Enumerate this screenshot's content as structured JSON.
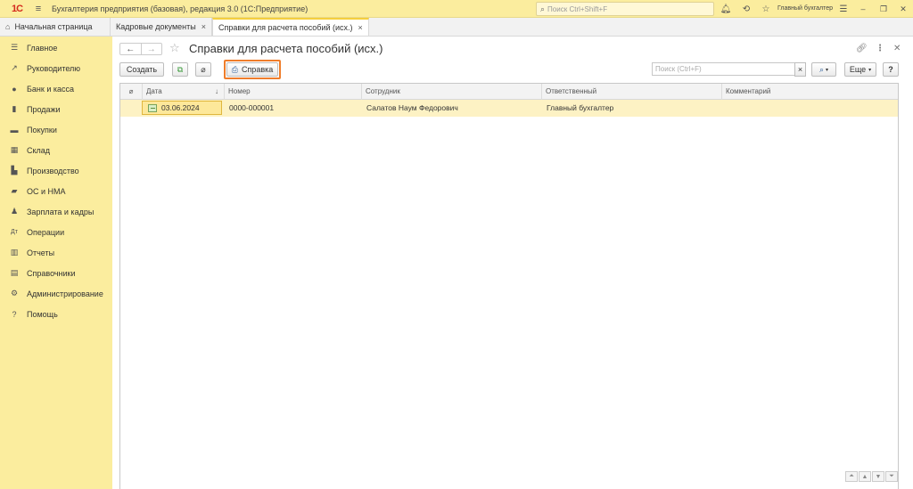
{
  "titlebar": {
    "logo": "1С",
    "app_title": "Бухгалтерия предприятия (базовая), редакция 3.0  (1С:Предприятие)",
    "search_placeholder": "Поиск Ctrl+Shift+F",
    "user": "Главный бухгалтер",
    "icons": [
      "menu-icon",
      "search-icon",
      "bell-icon",
      "history-icon",
      "star-icon",
      "settings-icon",
      "minimize-icon",
      "restore-icon",
      "close-icon"
    ]
  },
  "tabs": {
    "home": "Начальная страница",
    "items": [
      {
        "label": "Кадровые документы",
        "close": "×"
      },
      {
        "label": "Справки для расчета пособий (исх.)",
        "close": "×"
      }
    ]
  },
  "sidebar": {
    "items": [
      {
        "label": "Главное",
        "icon": "menu-icon"
      },
      {
        "label": "Руководителю",
        "icon": "chart-up-icon"
      },
      {
        "label": "Банк и касса",
        "icon": "coins-icon"
      },
      {
        "label": "Продажи",
        "icon": "bag-icon"
      },
      {
        "label": "Покупки",
        "icon": "cart-icon"
      },
      {
        "label": "Склад",
        "icon": "warehouse-icon"
      },
      {
        "label": "Производство",
        "icon": "factory-icon"
      },
      {
        "label": "ОС и НМА",
        "icon": "truck-icon"
      },
      {
        "label": "Зарплата и кадры",
        "icon": "person-icon"
      },
      {
        "label": "Операции",
        "icon": "operations-icon"
      },
      {
        "label": "Отчеты",
        "icon": "report-icon"
      },
      {
        "label": "Справочники",
        "icon": "book-icon"
      },
      {
        "label": "Администрирование",
        "icon": "gear-icon"
      },
      {
        "label": "Помощь",
        "icon": "help-icon"
      }
    ]
  },
  "form": {
    "title": "Справки для расчета пособий (исх.)",
    "create_label": "Создать",
    "print_label": "Справка",
    "search_placeholder": "Поиск (Ctrl+F)",
    "clear_label": "×",
    "more_label": "Еще",
    "help_label": "?"
  },
  "table": {
    "columns": [
      "Дата",
      "Номер",
      "Сотрудник",
      "Ответственный",
      "Комментарий"
    ],
    "sort_indicator": "↓",
    "rows": [
      {
        "date": "03.06.2024",
        "number": "0000-000001",
        "employee": "Салатов Наум Федорович",
        "responsible": "Главный бухгалтер",
        "comment": ""
      }
    ]
  },
  "colors": {
    "accent_yellow": "#fbed9e",
    "selected_row": "#fdf2c4",
    "highlight_orange": "#ef7d2b"
  }
}
